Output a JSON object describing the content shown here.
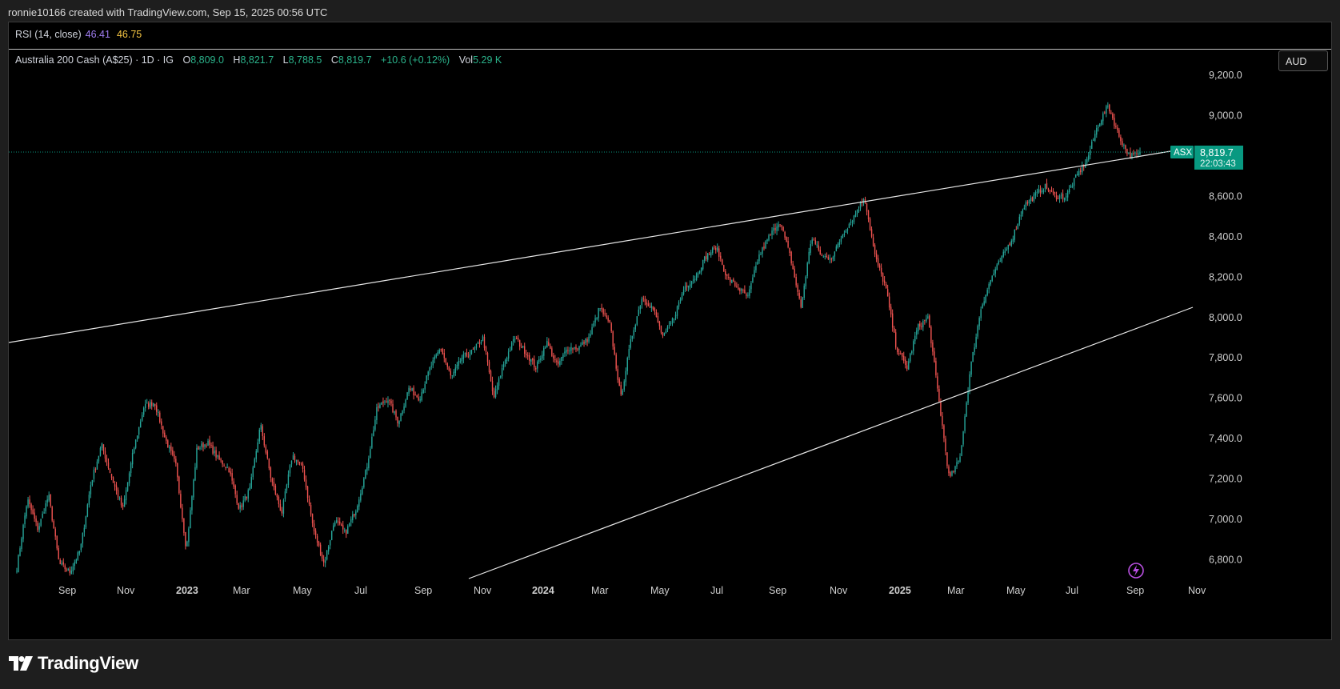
{
  "caption": "ronnie10166 created with TradingView.com, Sep 15, 2025 00:56 UTC",
  "rsi": {
    "label": "RSI (14, close)",
    "value1": "46.41",
    "value2": "46.75"
  },
  "legend": {
    "symbol": "Australia 200 Cash (A$25) · 1D · IG",
    "o_label": "O",
    "o": "8,809.0",
    "h_label": "H",
    "h": "8,821.7",
    "l_label": "L",
    "l": "8,788.5",
    "c_label": "C",
    "c": "8,819.7",
    "change": "+10.6 (+0.12%)",
    "vol_label": "Vol",
    "vol": "5.29 K"
  },
  "currency": "AUD",
  "price_axis": {
    "ticks": [
      "9,200.0",
      "9,000.0",
      "8,600.0",
      "8,400.0",
      "8,200.0",
      "8,000.0",
      "7,800.0",
      "7,600.0",
      "7,400.0",
      "7,200.0",
      "7,000.0",
      "6,800.0"
    ],
    "last_price": "8,819.7",
    "countdown": "22:03:43",
    "exchange_tag": "ASX"
  },
  "time_axis": [
    "Sep",
    "Nov",
    "2023",
    "Mar",
    "May",
    "Jul",
    "Sep",
    "Nov",
    "2024",
    "Mar",
    "May",
    "Jul",
    "Sep",
    "Nov",
    "2025",
    "Mar",
    "May",
    "Jul",
    "Sep",
    "Nov"
  ],
  "brand": "TradingView",
  "colors": {
    "up": "#26a69a",
    "down": "#ef5350",
    "accent": "#089981",
    "rsi1": "#9f7cf0",
    "rsi2": "#f5c542"
  },
  "chart_data": {
    "type": "candlestick",
    "ylim": [
      6750,
      9230
    ],
    "series": [
      {
        "values": [
          6760,
          7100,
          6950,
          7120,
          6780,
          6740,
          6850,
          7180,
          7370,
          7200,
          7050,
          7340,
          7560,
          7580,
          7400,
          7270,
          6850,
          7350,
          7380,
          7300,
          7250,
          7050,
          7150,
          7470,
          7200,
          7030,
          7320,
          7250,
          6950,
          6780,
          7000,
          6930,
          7050,
          7250,
          7550,
          7600,
          7480,
          7650,
          7600,
          7750,
          7850,
          7700,
          7800,
          7830,
          7900,
          7600,
          7780,
          7900,
          7830,
          7750,
          7880,
          7760,
          7850,
          7850,
          7900,
          8050,
          7960,
          7600,
          7900,
          8100,
          8050,
          7900,
          8000,
          8150,
          8200,
          8300,
          8350,
          8200,
          8150,
          8100,
          8300,
          8400,
          8480,
          8300,
          8050,
          8400,
          8300,
          8300,
          8420,
          8500,
          8600,
          8300,
          8150,
          7850,
          7750,
          7950,
          8000,
          7600,
          7200,
          7300,
          7750,
          8050,
          8200,
          8300,
          8400,
          8550,
          8600,
          8650,
          8600,
          8600,
          8700,
          8780,
          8950,
          9050,
          8900,
          8800,
          8810
        ]
      }
    ],
    "trendlines": [
      "upper resistance line",
      "lower support line"
    ]
  }
}
